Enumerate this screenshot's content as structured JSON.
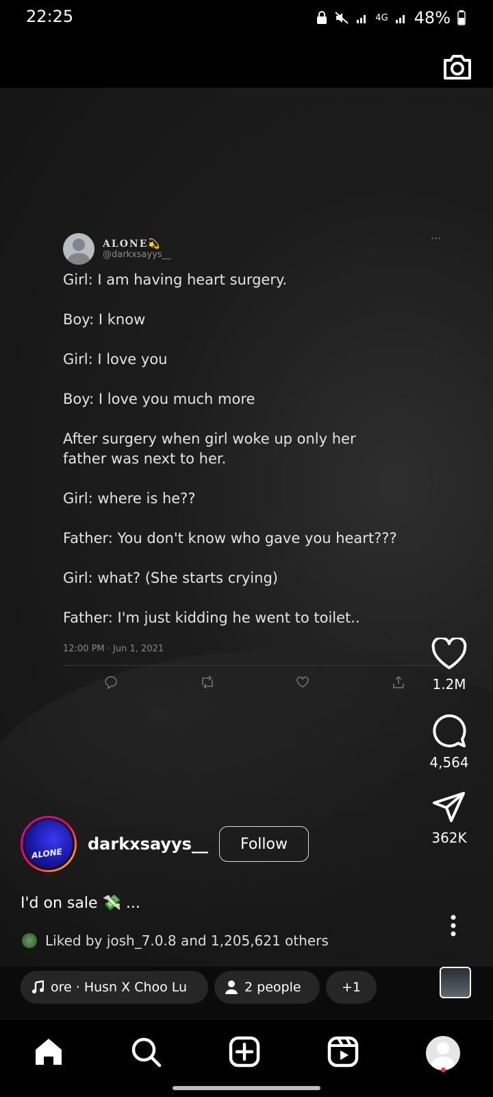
{
  "status_bar": {
    "time": "22:25",
    "network": "4G",
    "battery": "48%"
  },
  "tweet": {
    "name": "ALONE💫",
    "handle": "@darkxsayys__",
    "more": "···",
    "lines": [
      "Girl: I am having heart surgery.",
      "Boy: I know",
      "Girl: I love you",
      "Boy: I love you much more",
      "After surgery when girl woke up only her father was next to her.",
      "Girl: where is he??",
      "Father: You don't know who gave you heart???",
      "Girl: what? (She starts crying)",
      "Father: I'm just kidding he went to toilet.."
    ],
    "timestamp": "12:00 PM · Jun 1, 2021"
  },
  "actions": {
    "likes": "1.2M",
    "comments": "4,564",
    "shares": "362K"
  },
  "author": {
    "username": "darkxsayys__",
    "avatar_text": "ALONE",
    "follow_label": "Follow"
  },
  "caption": "I'd on sale 💸 ...",
  "likes_text": "Liked by josh_7.0.8 and 1,205,621 others",
  "chips": {
    "music": "ore · Husn X Choo Lu",
    "people": "2 people",
    "plus": "+1"
  }
}
